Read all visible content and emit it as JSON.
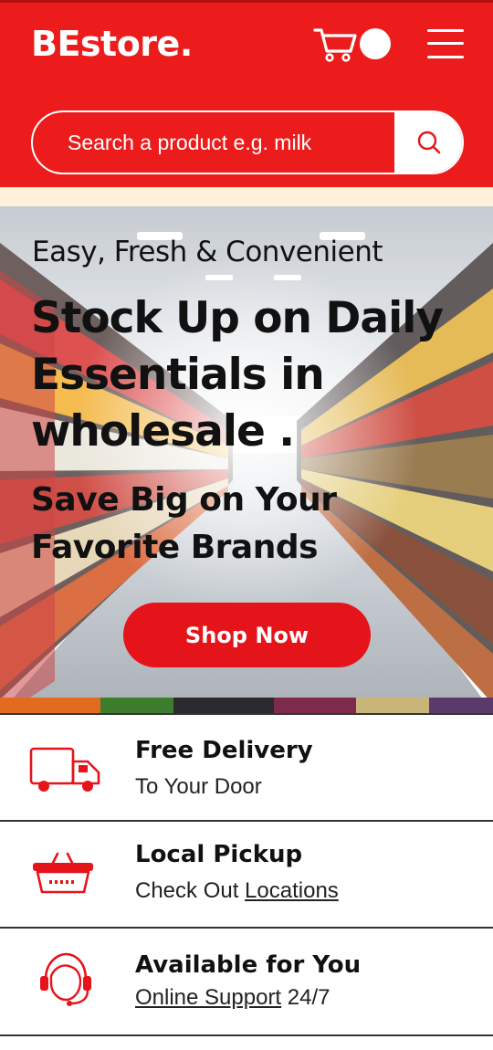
{
  "header": {
    "logo": "BEstore.",
    "search_placeholder": "Search a product e.g. milk"
  },
  "hero": {
    "subtitle": "Easy, Fresh & Convenient",
    "title": "Stock Up on Daily Essentials in wholesale .",
    "tagline": "Save Big on Your Favorite Brands",
    "cta": "Shop Now"
  },
  "features": [
    {
      "title": "Free Delivery",
      "subtitle": "To Your Door",
      "icon": "delivery-truck-icon"
    },
    {
      "title": "Local Pickup",
      "subtitle_prefix": "Check Out ",
      "subtitle_link": "Locations",
      "icon": "shopping-basket-icon"
    },
    {
      "title": "Available for You",
      "subtitle_link": "Online Support",
      "subtitle_suffix": " 24/7",
      "icon": "support-headset-icon"
    }
  ],
  "colors": {
    "brand_red": "#ec1c1c",
    "cream": "#fdf1dc",
    "text": "#111111"
  }
}
